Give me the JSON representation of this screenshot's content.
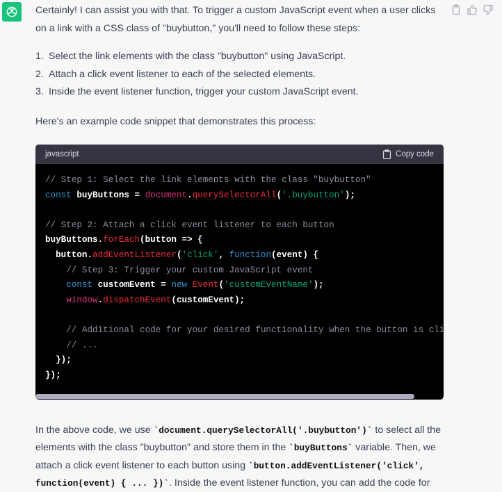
{
  "message": {
    "intro": "Certainly! I can assist you with that. To trigger a custom JavaScript event when a user clicks on a link with a CSS class of \"buybutton,\" you'll need to follow these steps:",
    "steps": [
      {
        "num": "1.",
        "text": "Select the link elements with the class \"buybutton\" using JavaScript."
      },
      {
        "num": "2.",
        "text": "Attach a click event listener to each of the selected elements."
      },
      {
        "num": "3.",
        "text": "Inside the event listener function, trigger your custom JavaScript event."
      }
    ],
    "snippet_intro": "Here's an example code snippet that demonstrates this process:",
    "code_language": "javascript",
    "copy_label": "Copy code",
    "code_lines": [
      [
        [
          "// Step 1: Select the link elements with the class \"buybutton\"",
          "com"
        ]
      ],
      [
        [
          "const",
          "kw"
        ],
        [
          " buyButtons = ",
          "pl"
        ],
        [
          "document",
          "var"
        ],
        [
          ".",
          "pl"
        ],
        [
          "querySelectorAll",
          "fn"
        ],
        [
          "(",
          "pl"
        ],
        [
          "'.buybutton'",
          "str"
        ],
        [
          ");",
          "pl"
        ]
      ],
      [],
      [
        [
          "// Step 2: Attach a click event listener to each button",
          "com"
        ]
      ],
      [
        [
          "buyButtons.",
          "pl"
        ],
        [
          "forEach",
          "fn"
        ],
        [
          "(button => {",
          "pl"
        ]
      ],
      [
        [
          "  button.",
          "pl"
        ],
        [
          "addEventListener",
          "fn"
        ],
        [
          "(",
          "pl"
        ],
        [
          "'click'",
          "str"
        ],
        [
          ", ",
          "pl"
        ],
        [
          "function",
          "kw"
        ],
        [
          "(event) {",
          "pl"
        ]
      ],
      [
        [
          "    // Step 3: Trigger your custom JavaScript event",
          "com"
        ]
      ],
      [
        [
          "    ",
          "pl"
        ],
        [
          "const",
          "kw"
        ],
        [
          " customEvent = ",
          "pl"
        ],
        [
          "new",
          "kw"
        ],
        [
          " ",
          "pl"
        ],
        [
          "Event",
          "fn"
        ],
        [
          "(",
          "pl"
        ],
        [
          "'customEventName'",
          "str"
        ],
        [
          ");",
          "pl"
        ]
      ],
      [
        [
          "    ",
          "pl"
        ],
        [
          "window",
          "var"
        ],
        [
          ".",
          "pl"
        ],
        [
          "dispatchEvent",
          "fn"
        ],
        [
          "(customEvent);",
          "pl"
        ]
      ],
      [],
      [
        [
          "    // Additional code for your desired functionality when the button is clicked",
          "com"
        ]
      ],
      [
        [
          "    // ...",
          "com"
        ]
      ],
      [
        [
          "  });",
          "pl"
        ]
      ],
      [
        [
          "});",
          "pl"
        ]
      ]
    ],
    "explanation": [
      {
        "t": "In the above code, we use ",
        "code": false
      },
      {
        "t": "`document.querySelectorAll('.buybutton')`",
        "code": true
      },
      {
        "t": " to select all the elements with the class \"buybutton\" and store them in the ",
        "code": false
      },
      {
        "t": "`buyButtons`",
        "code": true
      },
      {
        "t": " variable. Then, we attach a click event listener to each button using ",
        "code": false
      },
      {
        "t": "`button.addEventListener('click', function(event) { ... })`",
        "code": true
      },
      {
        "t": ". Inside the event listener function, you can add the code for",
        "code": false
      }
    ]
  },
  "colors": {
    "avatar": "#19c37d",
    "code_bg": "#000000",
    "code_header": "#343541"
  }
}
